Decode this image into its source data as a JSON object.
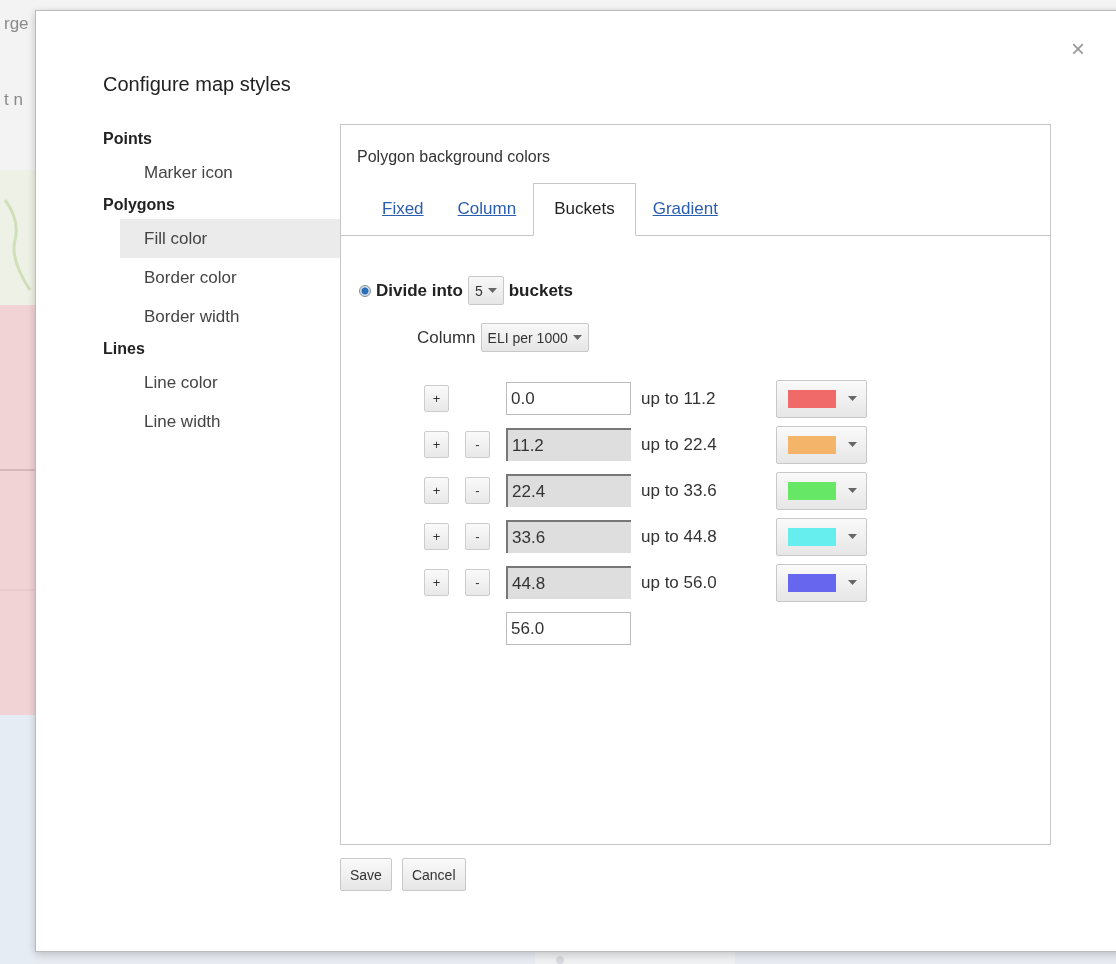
{
  "background": {
    "fragments": [
      "rge",
      "t n"
    ]
  },
  "dialog": {
    "title": "Configure map styles",
    "close": "×"
  },
  "sidebar": [
    {
      "heading": "Points",
      "items": [
        {
          "label": "Marker icon",
          "selected": false
        }
      ]
    },
    {
      "heading": "Polygons",
      "items": [
        {
          "label": "Fill color",
          "selected": true
        },
        {
          "label": "Border color",
          "selected": false
        },
        {
          "label": "Border width",
          "selected": false
        }
      ]
    },
    {
      "heading": "Lines",
      "items": [
        {
          "label": "Line color",
          "selected": false
        },
        {
          "label": "Line width",
          "selected": false
        }
      ]
    }
  ],
  "panel": {
    "title": "Polygon background colors",
    "tabs": [
      {
        "label": "Fixed",
        "selected": false
      },
      {
        "label": "Column",
        "selected": false
      },
      {
        "label": "Buckets",
        "selected": true
      },
      {
        "label": "Gradient",
        "selected": false
      }
    ],
    "divide": {
      "selected": true,
      "label": "Divide into",
      "count": "5",
      "suffix": "buckets"
    },
    "column": {
      "label": "Column",
      "value": "ELI per 1000"
    },
    "buckets": [
      {
        "add": "+",
        "from": "0.0",
        "disabled": false,
        "to": "up to 11.2",
        "color": "#f06a6a"
      },
      {
        "add": "+",
        "remove": "-",
        "from": "11.2",
        "disabled": true,
        "to": "up to 22.4",
        "color": "#f4b56a"
      },
      {
        "add": "+",
        "remove": "-",
        "from": "22.4",
        "disabled": true,
        "to": "up to 33.6",
        "color": "#66e866"
      },
      {
        "add": "+",
        "remove": "-",
        "from": "33.6",
        "disabled": true,
        "to": "up to 44.8",
        "color": "#66eeee"
      },
      {
        "add": "+",
        "remove": "-",
        "from": "44.8",
        "disabled": true,
        "to": "up to 56.0",
        "color": "#6666ee"
      }
    ],
    "last": "56.0"
  },
  "buttons": [
    "Save",
    "Cancel"
  ]
}
